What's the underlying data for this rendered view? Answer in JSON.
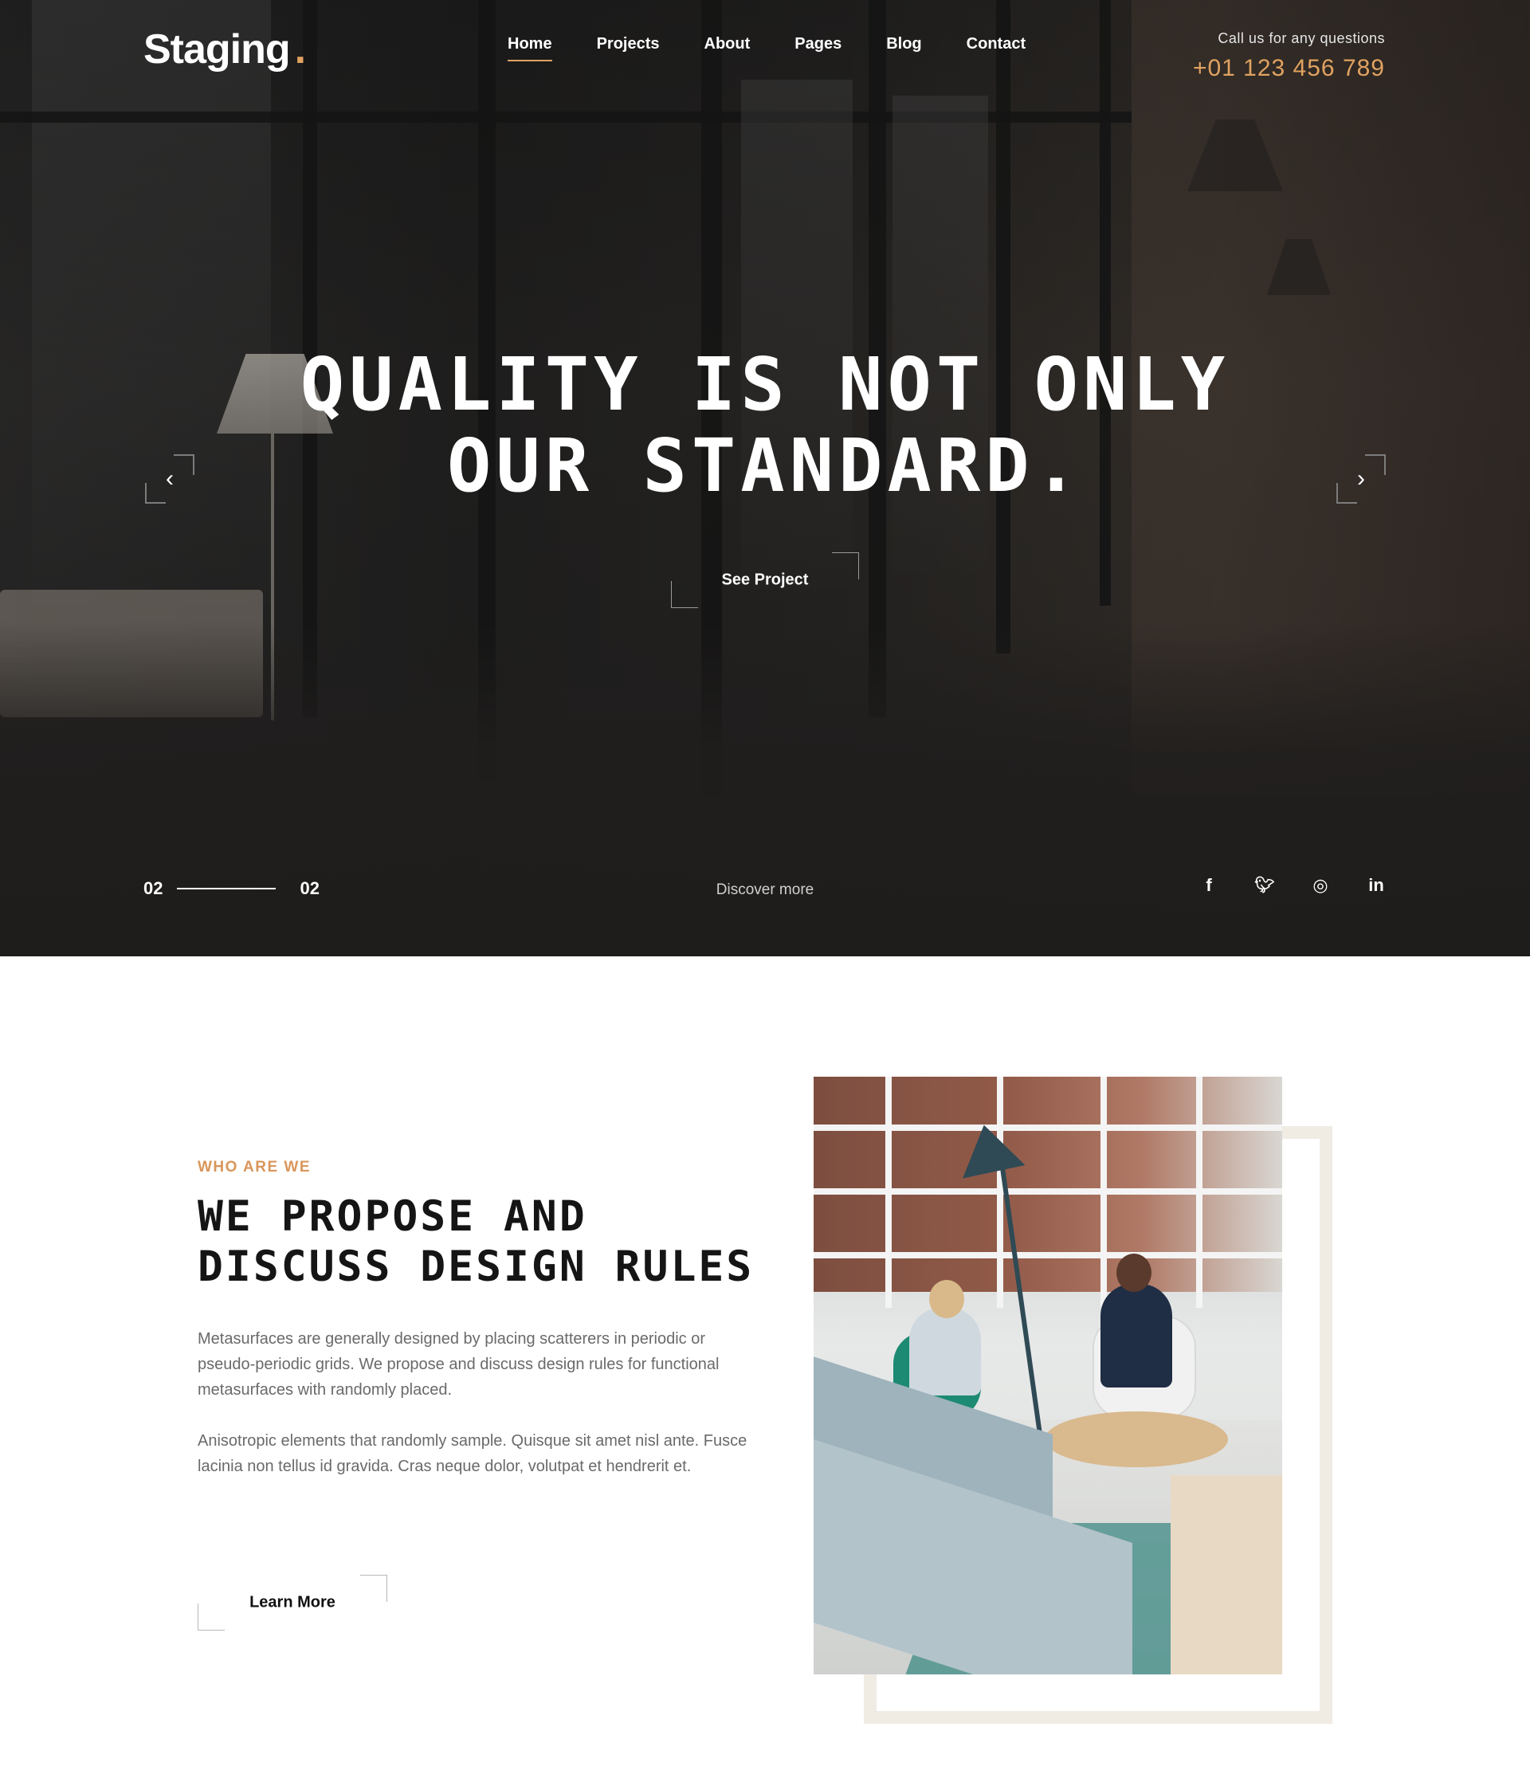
{
  "brand": {
    "name": "Staging",
    "dot": "."
  },
  "nav": {
    "items": [
      {
        "label": "Home",
        "active": true
      },
      {
        "label": "Projects",
        "active": false
      },
      {
        "label": "About",
        "active": false
      },
      {
        "label": "Pages",
        "active": false
      },
      {
        "label": "Blog",
        "active": false
      },
      {
        "label": "Contact",
        "active": false
      }
    ]
  },
  "contact": {
    "prompt": "Call us for any questions",
    "phone": "+01 123 456 789"
  },
  "hero": {
    "title_line1": "QUALITY IS NOT ONLY",
    "title_line2": "OUR STANDARD.",
    "cta_label": "See Project",
    "prev_icon": "chevron-left-icon",
    "next_icon": "chevron-right-icon",
    "slide_current": "02",
    "slide_total": "02",
    "discover_label": "Discover more",
    "social": [
      {
        "icon": "facebook-icon",
        "glyph": "f"
      },
      {
        "icon": "twitter-icon",
        "glyph": "🐦"
      },
      {
        "icon": "instagram-icon",
        "glyph": "◎"
      },
      {
        "icon": "linkedin-icon",
        "glyph": "in"
      }
    ]
  },
  "about": {
    "eyebrow": "WHO ARE WE",
    "title_line1": "WE PROPOSE AND",
    "title_line2": "DISCUSS DESIGN RULES",
    "paragraph1": "Metasurfaces are generally designed by placing scatterers in periodic or pseudo-periodic grids. We propose and discuss design rules for functional metasurfaces with randomly placed.",
    "paragraph2": "Anisotropic elements that randomly sample. Quisque sit amet nisl ante. Fusce lacinia non tellus id gravida. Cras neque dolor, volutpat et hendrerit et.",
    "cta_label": "Learn More"
  },
  "colors": {
    "accent": "#e0a260",
    "eyebrow": "#d9965a",
    "frame": "#f0ece4"
  }
}
